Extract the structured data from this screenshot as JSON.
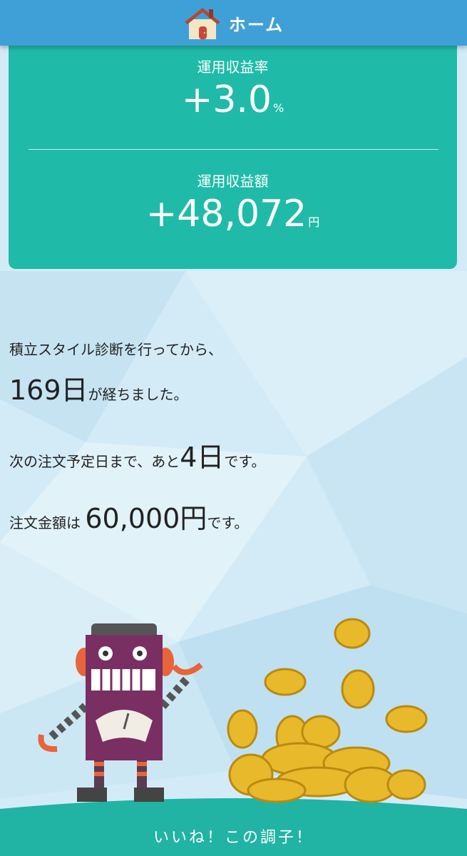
{
  "header": {
    "title": "ホーム"
  },
  "returns": {
    "rate_label": "運用収益率",
    "rate_value": "+3.0",
    "rate_unit": "%",
    "amount_label": "運用収益額",
    "amount_value": "+48,072",
    "amount_unit": "円"
  },
  "summary": {
    "line1": "積立スタイル診断を行ってから、",
    "days_value": "169日",
    "days_suffix": "が経ちました。",
    "next_order_prefix": "次の注文予定日まで、あと",
    "next_order_days": "4日",
    "next_order_suffix": "です。",
    "amount_prefix": "注文金額は",
    "amount_value": "60,000円",
    "amount_suffix": "です。"
  },
  "footer": {
    "message": "いいね！この調子！"
  },
  "colors": {
    "header_bg": "#3fa0d8",
    "card_bg": "#1fbba8",
    "footer_bg": "#21b3a4",
    "page_bg": "#cfe9f5"
  },
  "icons": [
    "house-icon",
    "robot-illustration",
    "coins-illustration"
  ]
}
